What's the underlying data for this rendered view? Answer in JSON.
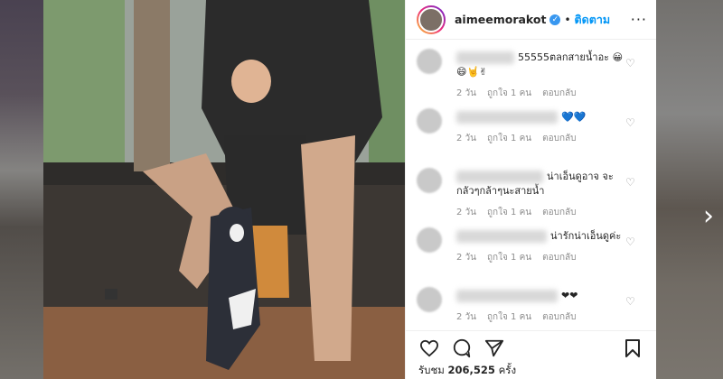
{
  "nav": {
    "next_arrow": "›"
  },
  "post": {
    "username": "aimeemorakot",
    "verified_icon": "verified-badge-icon",
    "separator": "•",
    "follow_label": "ติดตาม",
    "more_label": "···"
  },
  "comments": [
    {
      "text": "55555ตลกสายน้ำอะ 😀😄🤘✌",
      "time": "2 วัน",
      "likes": "ถูกใจ 1 คน",
      "reply": "ตอบกลับ"
    },
    {
      "text": "💙💙",
      "time": "2 วัน",
      "likes": "ถูกใจ 1 คน",
      "reply": "ตอบกลับ"
    },
    {
      "text": "น่าเอ็นดูอาจ จะกลัวๆกล้าๆนะสายน้ำ",
      "time": "2 วัน",
      "likes": "ถูกใจ 1 คน",
      "reply": "ตอบกลับ"
    },
    {
      "text": "น่ารักน่าเอ็นดูค่ะ",
      "time": "2 วัน",
      "likes": "ถูกใจ 1 คน",
      "reply": "ตอบกลับ"
    },
    {
      "text": "❤❤",
      "time": "2 วัน",
      "likes": "ถูกใจ 1 คน",
      "reply": "ตอบกลับ"
    }
  ],
  "footer": {
    "views_label": "รับชม",
    "views_count": "206,525",
    "views_unit": "ครั้ง"
  },
  "colors": {
    "accent": "#0095f6",
    "text": "#262626",
    "muted": "#8e8e8e"
  }
}
